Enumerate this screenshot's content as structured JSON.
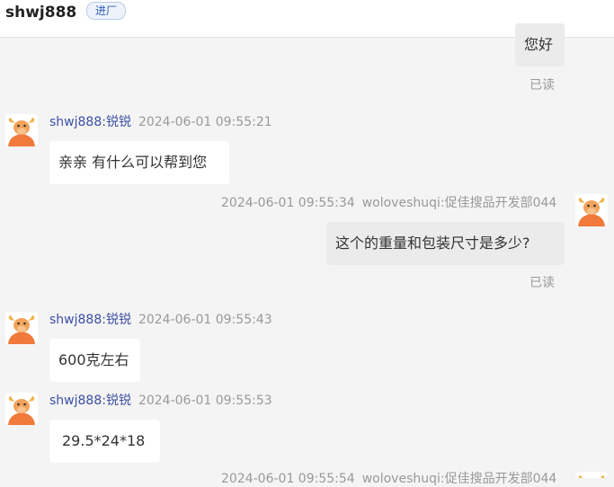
{
  "header": {
    "username": "shwj888",
    "badge": "进厂"
  },
  "read_label": "已读",
  "messages": [
    {
      "direction": "outgoing",
      "text": "您好",
      "status": "已读"
    },
    {
      "direction": "incoming",
      "sender": "shwj888:锐锐",
      "time": "2024-06-01 09:55:21",
      "text": "亲亲 有什么可以帮到您"
    },
    {
      "direction": "outgoing",
      "sender": "woloveshuqi:促佳搜品开发部044",
      "time": "2024-06-01 09:55:34",
      "text": "这个的重量和包装尺寸是多少?",
      "status": "已读"
    },
    {
      "direction": "incoming",
      "sender": "shwj888:锐锐",
      "time": "2024-06-01 09:55:43",
      "text": "600克左右"
    },
    {
      "direction": "incoming",
      "sender": "shwj888:锐锐",
      "time": "2024-06-01 09:55:53",
      "text": "29.5*24*18"
    },
    {
      "direction": "outgoing",
      "sender": "woloveshuqi:促佳搜品开发部044",
      "time": "2024-06-01 09:55:54"
    }
  ],
  "colors": {
    "background": "#f4f4f4",
    "incoming_bubble": "#ffffff",
    "outgoing_bubble": "#ebebeb",
    "sender_name": "#3b4fa3",
    "meta_gray": "#999999",
    "badge_text": "#2e5fb8",
    "avatar_orange": "#f07a3c"
  }
}
